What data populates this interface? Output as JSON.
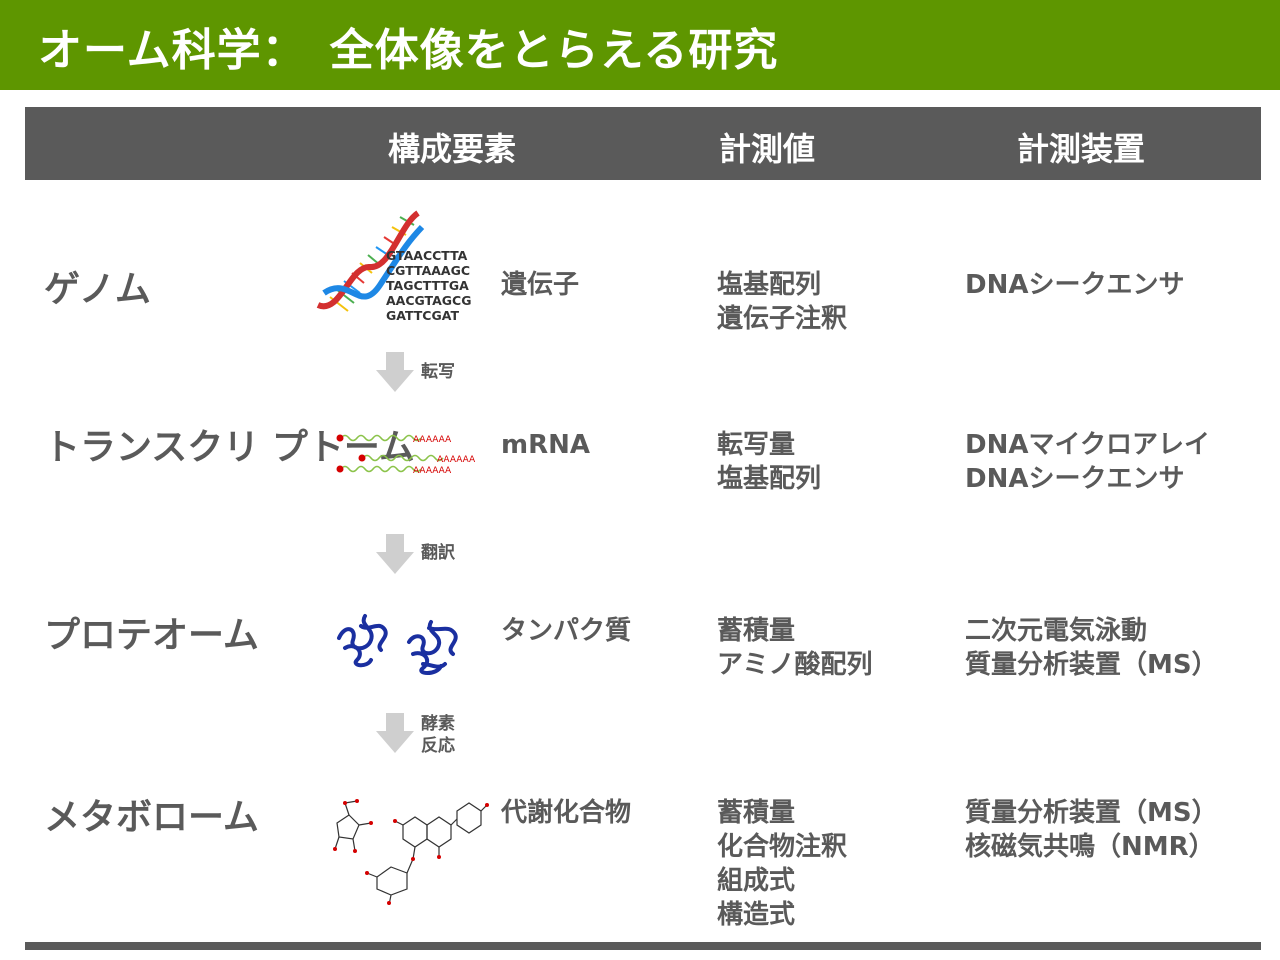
{
  "title": "オーム科学：　全体像をとらえる研究",
  "headers": {
    "components": "構成要素",
    "measured": "計測値",
    "instrument": "計測装置"
  },
  "rows": [
    {
      "omic": [
        "ゲノム"
      ],
      "component": "遺伝子",
      "measured": [
        "塩基配列",
        "遺伝子注釈"
      ],
      "instrument": [
        "DNAシークエンサ"
      ]
    },
    {
      "omic": [
        "トランスクリ",
        "プトーム"
      ],
      "component": "mRNA",
      "measured": [
        "転写量",
        "塩基配列"
      ],
      "instrument": [
        "DNAマイクロアレイ",
        "DNAシークエンサ"
      ]
    },
    {
      "omic": [
        "プロテオーム"
      ],
      "component": "タンパク質",
      "measured": [
        "蓄積量",
        "アミノ酸配列"
      ],
      "instrument": [
        "二次元電気泳動",
        "質量分析装置（MS）"
      ]
    },
    {
      "omic": [
        "メタボローム"
      ],
      "component": "代謝化合物",
      "measured": [
        "蓄積量",
        "化合物注釈",
        "組成式",
        "構造式"
      ],
      "instrument": [
        "質量分析装置（MS）",
        "核磁気共鳴（NMR）"
      ]
    }
  ],
  "arrows": [
    {
      "label": [
        "転写"
      ]
    },
    {
      "label": [
        "翻訳"
      ]
    },
    {
      "label": [
        "酵素",
        "反応"
      ]
    }
  ],
  "dna_sequence": [
    "GTAACCTTA",
    "CGTTAAAGC",
    "TAGCTTTGA",
    "AACGTAGCG",
    "GATTCGAT"
  ],
  "mrna_tails": [
    "AAAAAA",
    "AAAAAA",
    "AAAAAA"
  ],
  "colors": {
    "title_bar": "#5e9600",
    "header_bar": "#5a5a5a",
    "text": "#5a5a5a",
    "protein": "#1a2fa0",
    "mrna_wave": "#8bc34a",
    "mrna_cap": "#d50000"
  }
}
